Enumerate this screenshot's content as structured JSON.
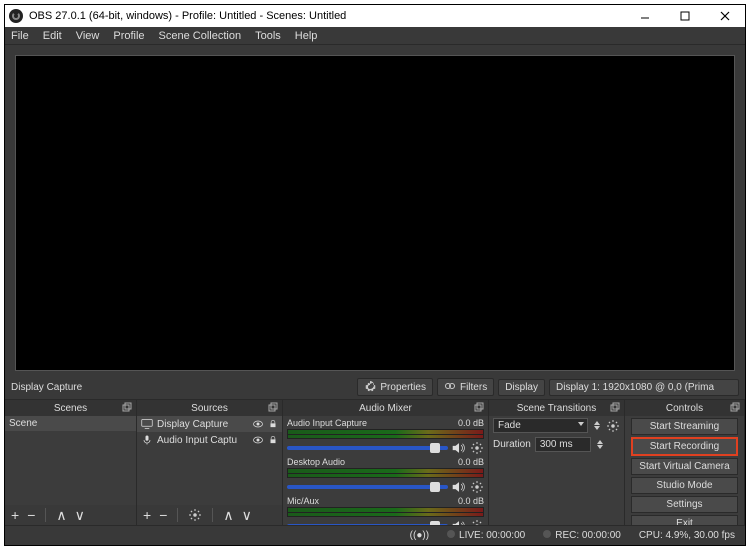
{
  "titlebar": {
    "title": "OBS 27.0.1 (64-bit, windows) - Profile: Untitled - Scenes: Untitled"
  },
  "menu": {
    "file": "File",
    "edit": "Edit",
    "view": "View",
    "profile": "Profile",
    "scene_collection": "Scene Collection",
    "tools": "Tools",
    "help": "Help"
  },
  "info_row": {
    "selected_source": "Display Capture",
    "properties": "Properties",
    "filters": "Filters",
    "display_label": "Display",
    "display_value": "Display 1: 1920x1080 @ 0,0 (Prima"
  },
  "panels": {
    "scenes": {
      "title": "Scenes",
      "items": [
        "Scene"
      ]
    },
    "sources": {
      "title": "Sources",
      "items": [
        {
          "name": "Display Capture",
          "icon": "monitor"
        },
        {
          "name": "Audio Input Captu",
          "icon": "mic"
        }
      ]
    },
    "mixer": {
      "title": "Audio Mixer",
      "items": [
        {
          "name": "Audio Input Capture",
          "db": "0.0 dB"
        },
        {
          "name": "Desktop Audio",
          "db": "0.0 dB"
        },
        {
          "name": "Mic/Aux",
          "db": "0.0 dB"
        }
      ]
    },
    "transitions": {
      "title": "Scene Transitions",
      "fade": "Fade",
      "duration_label": "Duration",
      "duration_value": "300 ms"
    },
    "controls": {
      "title": "Controls",
      "buttons": [
        {
          "label": "Start Streaming",
          "hl": false
        },
        {
          "label": "Start Recording",
          "hl": true
        },
        {
          "label": "Start Virtual Camera",
          "hl": false
        },
        {
          "label": "Studio Mode",
          "hl": false
        },
        {
          "label": "Settings",
          "hl": false
        },
        {
          "label": "Exit",
          "hl": false
        }
      ]
    }
  },
  "status": {
    "live": "LIVE: 00:00:00",
    "rec": "REC: 00:00:00",
    "cpu": "CPU: 4.9%, 30.00 fps"
  }
}
